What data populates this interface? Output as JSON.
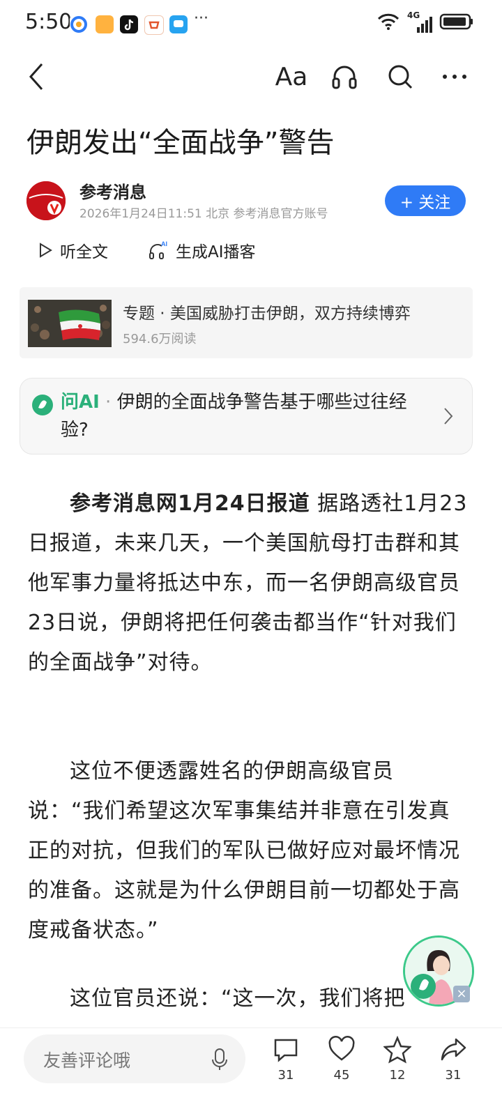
{
  "status_bar": {
    "time": "5:50",
    "more": "···",
    "network": "4G"
  },
  "article": {
    "title": "伊朗发出“全面战争”警告",
    "author": "参考消息",
    "meta": "2026年1月24日11:51 北京 参考消息官方账号",
    "follow_label": "+ 关注",
    "listen_label": "听全文",
    "podcast_label": "生成AI播客",
    "topic": {
      "title": "专题 · 美国威胁打击伊朗，双方持续博弈",
      "reads": "594.6万阅读"
    },
    "ask_ai": {
      "label": "问AI",
      "separator": " · ",
      "question": "伊朗的全面战争警告基于哪些过往经验?"
    },
    "paragraphs": [
      {
        "lead": "参考消息网1月24日报道",
        "text": " 据路透社1月23日报道，未来几天，一个美国航母打击群和其他军事力量将抵达中东，而一名伊朗高级官员23日说，伊朗将把任何袭击都当作“针对我们的全面战争”对待。"
      },
      {
        "lead": "",
        "text": "这位不便透露姓名的伊朗高级官员说：“我们希望这次军事集结并非意在引发真正的对抗，但我们的军队已做好应对最坏情况的准备。这就是为什么伊朗目前一切都处于高度戒备状态。”"
      },
      {
        "lead": "",
        "text": "这位官员还说：“这一次，我们将把"
      }
    ]
  },
  "bottom_bar": {
    "comment_placeholder": "友善评论哦",
    "comments": "31",
    "likes": "45",
    "favorites": "12",
    "shares": "31"
  },
  "colors": {
    "accent_blue": "#2f7bf6",
    "ai_green": "#2bb07a",
    "brand_red": "#c8131b"
  }
}
